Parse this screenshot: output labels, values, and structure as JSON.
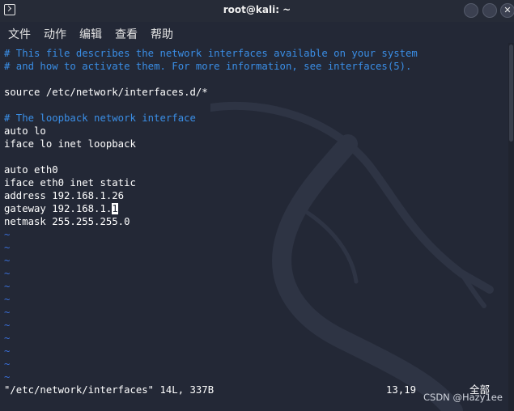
{
  "window": {
    "title": "root@kali: ~"
  },
  "menu": {
    "items": [
      "文件",
      "动作",
      "编辑",
      "查看",
      "帮助"
    ]
  },
  "editor": {
    "lines": [
      {
        "text": "# This file describes the network interfaces available on your system",
        "kind": "comment"
      },
      {
        "text": "# and how to activate them. For more information, see interfaces(5).",
        "kind": "comment"
      },
      {
        "text": "",
        "kind": "normal"
      },
      {
        "text": "source /etc/network/interfaces.d/*",
        "kind": "normal"
      },
      {
        "text": "",
        "kind": "normal"
      },
      {
        "text": "# The loopback network interface",
        "kind": "comment"
      },
      {
        "text": "auto lo",
        "kind": "normal"
      },
      {
        "text": "iface lo inet loopback",
        "kind": "normal"
      },
      {
        "text": "",
        "kind": "normal"
      },
      {
        "text": "auto eth0",
        "kind": "normal"
      },
      {
        "text": "iface eth0 inet static",
        "kind": "normal"
      },
      {
        "text": "address 192.168.1.26",
        "kind": "normal"
      },
      {
        "text": "gateway 192.168.1.1",
        "kind": "cursor",
        "cursor_index": 18
      },
      {
        "text": "netmask 255.255.255.0",
        "kind": "normal"
      },
      {
        "text": "~",
        "kind": "tilde"
      },
      {
        "text": "~",
        "kind": "tilde"
      },
      {
        "text": "~",
        "kind": "tilde"
      },
      {
        "text": "~",
        "kind": "tilde"
      },
      {
        "text": "~",
        "kind": "tilde"
      },
      {
        "text": "~",
        "kind": "tilde"
      },
      {
        "text": "~",
        "kind": "tilde"
      },
      {
        "text": "~",
        "kind": "tilde"
      },
      {
        "text": "~",
        "kind": "tilde"
      },
      {
        "text": "~",
        "kind": "tilde"
      },
      {
        "text": "~",
        "kind": "tilde"
      },
      {
        "text": "~",
        "kind": "tilde"
      }
    ],
    "status_file": "\"/etc/network/interfaces\" 14L, 337B",
    "status_position": "13,19",
    "status_scope": "全部"
  },
  "watermark": "CSDN @Hazy1ee",
  "colors": {
    "background": "#232836",
    "comment": "#3a8ee6",
    "tilde": "#3a6fd8",
    "text": "#ffffff"
  }
}
